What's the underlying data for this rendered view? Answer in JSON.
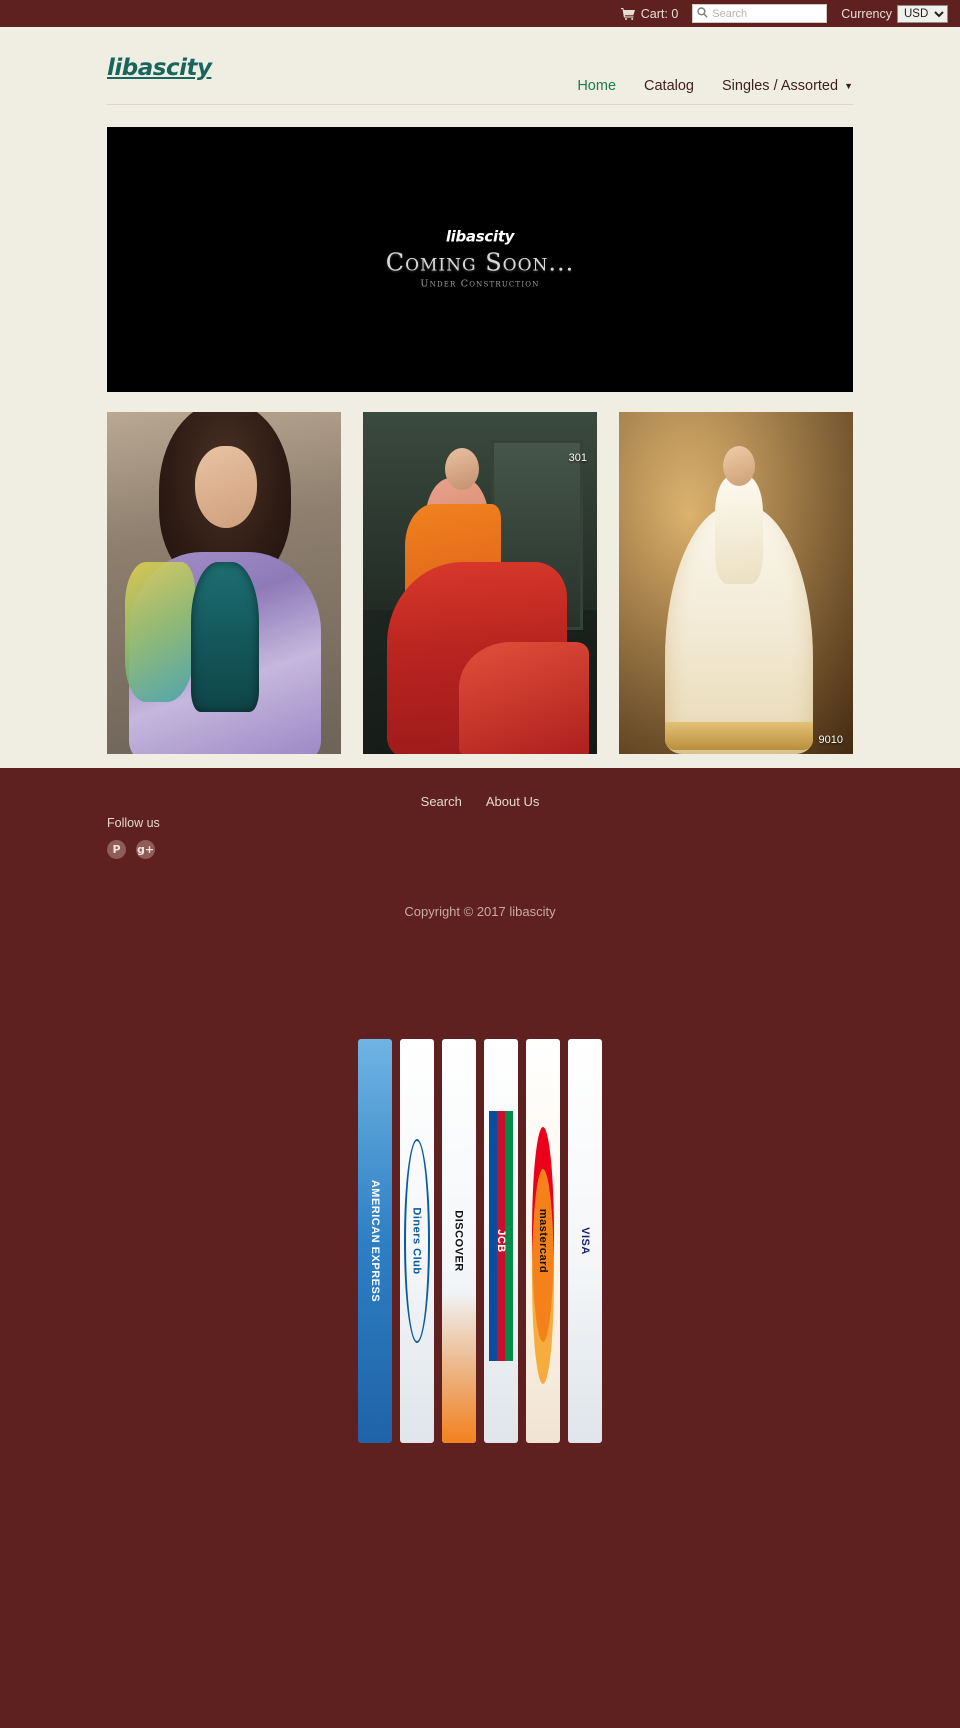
{
  "topbar": {
    "cart_label": "Cart: 0",
    "cart_icon": "shopping-cart-icon",
    "search_placeholder": "Search",
    "search_value": "",
    "search_icon": "search-icon",
    "currency_label": "Currency",
    "currency_selected": "USD",
    "currency_options": [
      "USD"
    ]
  },
  "header": {
    "logo_text": "libascity",
    "nav": [
      {
        "label": "Home",
        "active": true
      },
      {
        "label": "Catalog",
        "active": false
      },
      {
        "label": "Singles / Assorted",
        "active": false,
        "has_dropdown": true,
        "caret_icon": "chevron-down-icon"
      }
    ]
  },
  "hero": {
    "brand": "libascity",
    "title": "Coming Soon...",
    "subtitle": "Under Construction"
  },
  "products": [
    {
      "name": "product-1",
      "badge": ""
    },
    {
      "name": "product-2",
      "badge": "301"
    },
    {
      "name": "product-3",
      "badge": "9010"
    }
  ],
  "footer": {
    "links": [
      {
        "label": "Search"
      },
      {
        "label": "About Us"
      }
    ],
    "follow_label": "Follow us",
    "social": [
      {
        "name": "pinterest-icon",
        "glyph": "P"
      },
      {
        "name": "google-plus-icon",
        "glyph": "g+"
      }
    ],
    "copyright": "Copyright © 2017 libascity"
  },
  "payments": [
    {
      "name": "american-express",
      "label": "AMERICAN EXPRESS",
      "cls": "pay-amex"
    },
    {
      "name": "diners-club",
      "label": "Diners Club",
      "cls": "pay-diners"
    },
    {
      "name": "discover",
      "label": "DISCOVER",
      "cls": "pay-discover"
    },
    {
      "name": "jcb",
      "label": "JCB",
      "cls": "pay-jcb"
    },
    {
      "name": "mastercard",
      "label": "mastercard",
      "cls": "pay-master"
    },
    {
      "name": "visa",
      "label": "VISA",
      "cls": "pay-visa"
    }
  ],
  "colors": {
    "brand_maroon": "#5f2120",
    "page_cream": "#f0eee2",
    "logo_teal": "#18655e",
    "nav_active_green": "#1f7a4d"
  }
}
